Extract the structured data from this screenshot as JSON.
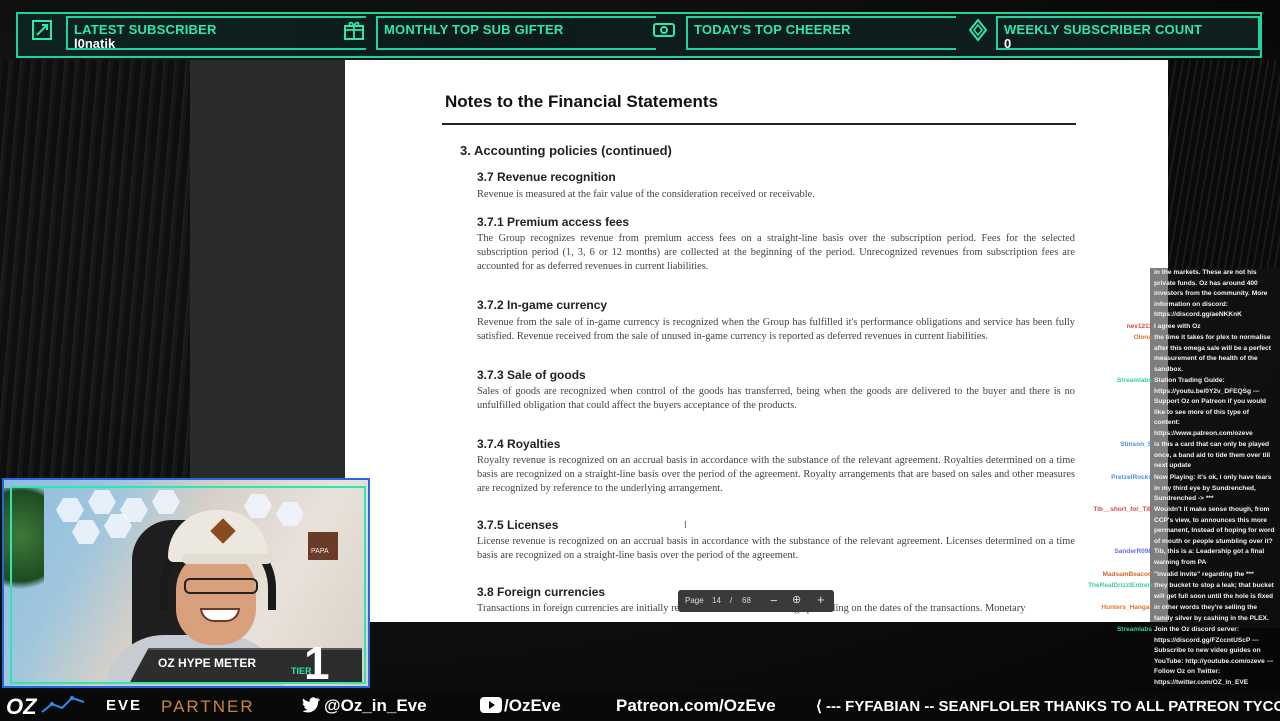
{
  "topbar": {
    "segments": [
      {
        "title": "LATEST SUBSCRIBER",
        "value": "l0natik",
        "icon": "plus-square-icon"
      },
      {
        "title": "MONTHLY TOP SUB GIFTER",
        "value": "",
        "icon": "gift-icon"
      },
      {
        "title": "TODAY'S TOP CHEERER",
        "value": "",
        "icon": "ticket-icon"
      },
      {
        "title": "WEEKLY SUBSCRIBER COUNT",
        "value": "0",
        "icon": "diamond-icon"
      }
    ]
  },
  "document": {
    "title": "Notes to the Financial Statements",
    "section": "3.  Accounting policies (continued)",
    "subsections": [
      {
        "heading": "3.7 Revenue recognition",
        "text": "Revenue is measured at the fair value of the consideration received or receivable."
      },
      {
        "heading": "3.7.1 Premium access fees",
        "text": "The Group recognizes revenue from premium access fees on a straight-line basis over the subscription period.  Fees for the selected subscription period (1, 3, 6 or 12 months) are collected at the beginning of the period.  Unrecognized revenues from subscription fees are accounted for as deferred revenues in current liabilities."
      },
      {
        "heading": "3.7.2 In-game currency",
        "text": "Revenue from the sale of in-game currency is recognized when the Group has fulfilled it's performance obligations and service has been fully satisfied. Revenue received from the sale of unused in-game currency is reported as deferred revenues in current liabilities."
      },
      {
        "heading": "3.7.3 Sale of goods",
        "text": "Sales of goods are recognized when control of the goods has transferred, being when the goods are delivered to the buyer and there is no unfulfilled obligation that could affect the buyers acceptance of the products."
      },
      {
        "heading": "3.7.4 Royalties",
        "text": "Royalty revenue is recognized on an accrual basis in accordance with the substance of the relevant agreement. Royalties determined on a time basis are recognized on a straight-line basis over the period of the agreement. Royalty arrangements that are based on sales and other measures are recognized by reference to the underlying arrangement."
      },
      {
        "heading": "3.7.5 Licenses",
        "text": "License revenue is recognized on an accrual basis in accordance with the substance of the relevant agreement. Licenses determined on a time basis are recognized on a straight-line basis over the period of the agreement."
      },
      {
        "heading": "3.8 Foreign currencies",
        "text": "Transactions in foreign currencies are initially recorded at the rate of exchange prevailing on the dates of the transactions.  Monetary"
      }
    ],
    "toolbar": {
      "page_label": "Page",
      "page": "14",
      "separator": "/",
      "total": "68"
    }
  },
  "chat": {
    "messages": [
      {
        "user": "",
        "color": "#ffffff",
        "text": "in the markets. These are not his private funds. Oz has around 400 investors from the community. More information on discord: https://discord.gg/aeNKKnK"
      },
      {
        "user": "nev1211",
        "color": "#d04a4a",
        "text": "I agree with Oz"
      },
      {
        "user": "Olona",
        "color": "#e0742c",
        "text": "the time it takes for plex to normalise after this omega sale will be a perfect measurement of the health of the sandbox."
      },
      {
        "user": "Streamlabs",
        "color": "#3fc7a6",
        "text": "Station Trading Guide: https://youtu.be/0Y2v_DFEQSg --- Support Oz on Patreon if you would like to see more of this type of content: https://www.patreon.com/ozeve"
      },
      {
        "user": "Stinson_S",
        "color": "#4a8ee0",
        "text": "is this a card that can only be played once, a band aid to tide them over till next update"
      },
      {
        "user": "PretzelRocks",
        "color": "#4a8ee0",
        "text": "Now Playing: it's ok, i only have tears in my third eye by Sundrenched, Sundrenched -> ***"
      },
      {
        "user": "Tib__short_for_Tib",
        "color": "#d04a4a",
        "text": "Wouldn't it make sense though, from CCP's view, to announces this more permanent, Instead of hoping for word of mouth or people stumbling over it?"
      },
      {
        "user": "SanderR098",
        "color": "#6a6ae0",
        "text": "Tib, this is a: Leadership got a final warning from PA"
      },
      {
        "user": "MadsamBeacon",
        "color": "#d06a2c",
        "text": "\"Invalid Invite\" regarding the ***"
      },
      {
        "user": "TheRealDrizztEntreri",
        "color": "#3fc7a6",
        "text": "they bucket to stop a leak; that bucket will get full soon until the hole is fixed"
      },
      {
        "user": "Hunters_Hangar",
        "color": "#e0742c",
        "text": "in other words they're selling the family silver by cashing in the PLEX."
      },
      {
        "user": "Streamlabs",
        "color": "#3fc7a6",
        "text": "Join the Oz discord server: https://discord.gg/FZccntUScP --- Subscribe to new video guides on YouTube: http://youtube.com/ozeve --- Follow Oz on Twitter: https://twitter.com/OZ_in_EVE"
      }
    ]
  },
  "webcam": {
    "poster_text": "PAPA",
    "hype_title": "OZ HYPE METER",
    "hype_tier_label": "TIER",
    "hype_value": "1"
  },
  "bottombar": {
    "logo": "OZ",
    "eve_logo": "EVE",
    "partner": "PARTNER",
    "twitter": "@Oz_in_Eve",
    "youtube": "/OzEve",
    "patreon": "Patreon.com/OzEve",
    "ticker": "⟨ --- FYFABIAN -- SEANFLOLER THANKS TO ALL PATREON TYCOON"
  },
  "colors": {
    "accent": "#1fd4a0",
    "cam_border": "#2569d9"
  }
}
